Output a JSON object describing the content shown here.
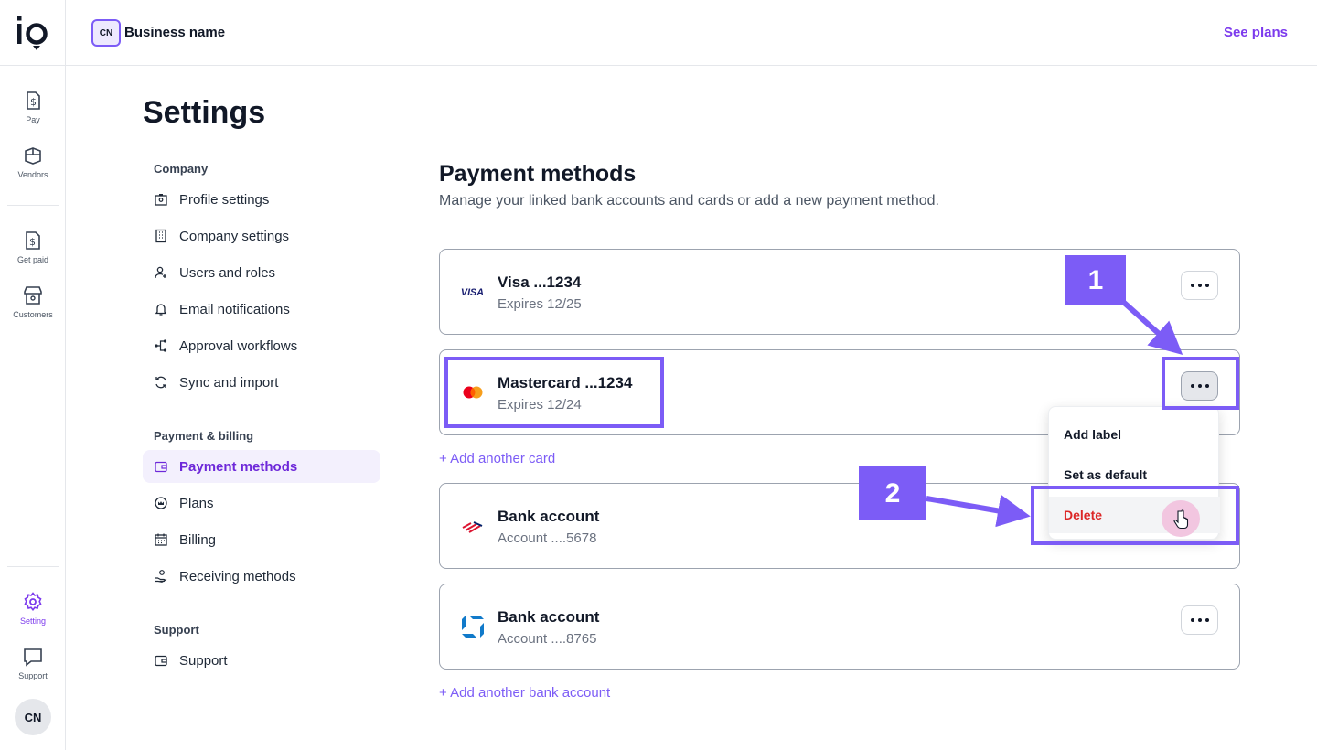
{
  "app": {
    "logo_text": "io",
    "business_initials": "CN",
    "business_name": "Business name",
    "see_plans": "See plans"
  },
  "rail": {
    "items": [
      {
        "label": "Pay",
        "icon": "dollar-doc-icon"
      },
      {
        "label": "Vendors",
        "icon": "box-icon"
      },
      {
        "label": "Get paid",
        "icon": "dollar-doc-icon"
      },
      {
        "label": "Customers",
        "icon": "store-icon"
      },
      {
        "label": "Setting",
        "icon": "gear-icon",
        "active": true
      },
      {
        "label": "Support",
        "icon": "chat-icon"
      }
    ],
    "avatar": "CN"
  },
  "page": {
    "title": "Settings"
  },
  "settings_nav": {
    "groups": [
      {
        "label": "Company"
      },
      {
        "label": "Payment & billing"
      },
      {
        "label": "Support"
      }
    ],
    "items": [
      {
        "label": "Profile settings",
        "icon": "badge-icon"
      },
      {
        "label": "Company settings",
        "icon": "building-icon"
      },
      {
        "label": "Users and roles",
        "icon": "user-plus-icon"
      },
      {
        "label": "Email notifications",
        "icon": "bell-icon"
      },
      {
        "label": "Approval workflows",
        "icon": "workflow-icon"
      },
      {
        "label": "Sync and import",
        "icon": "sync-icon"
      },
      {
        "label": "Payment methods",
        "icon": "wallet-icon",
        "active": true
      },
      {
        "label": "Plans",
        "icon": "crown-icon"
      },
      {
        "label": "Billing",
        "icon": "calendar-icon"
      },
      {
        "label": "Receiving methods",
        "icon": "hand-coin-icon"
      },
      {
        "label": "Support",
        "icon": "wallet-icon"
      }
    ]
  },
  "payment_methods": {
    "title": "Payment methods",
    "subtitle": "Manage your linked bank accounts and cards or add a new payment method.",
    "cards": [
      {
        "name": "Visa ...1234",
        "meta": "Expires 12/25",
        "logo": "visa-logo"
      },
      {
        "name": "Mastercard ...1234",
        "meta": "Expires 12/24",
        "logo": "mastercard-logo"
      }
    ],
    "add_card": "+ Add another card",
    "banks": [
      {
        "name": "Bank account",
        "meta": "Account ....5678",
        "logo": "bofa-logo"
      },
      {
        "name": "Bank account",
        "meta": "Account ....8765",
        "logo": "chase-logo"
      }
    ],
    "add_bank": "+ Add another bank account"
  },
  "menu": {
    "items": [
      "Add label",
      "Set as default",
      "Delete"
    ]
  },
  "annotations": {
    "step1": "1",
    "step2": "2"
  },
  "colors": {
    "accent": "#7c5cf6",
    "danger": "#dc2626",
    "active_bg": "#f3f0fd"
  }
}
